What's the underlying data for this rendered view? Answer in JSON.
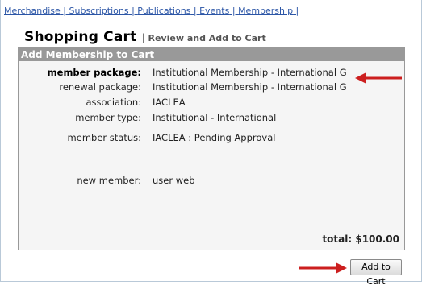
{
  "nav": {
    "links": [
      "Merchandise",
      "Subscriptions",
      "Publications",
      "Events",
      "Membership"
    ]
  },
  "header": {
    "title": "Shopping Cart",
    "subtitle": "Review and Add to Cart"
  },
  "panel": {
    "title": "Add Membership to Cart",
    "rows": [
      {
        "label": "member package:",
        "value": "Institutional Membership - International G"
      },
      {
        "label": "renewal package:",
        "value": "Institutional Membership - International G"
      },
      {
        "label": "association:",
        "value": "IACLEA"
      },
      {
        "label": "member type:",
        "value": "Institutional - International"
      },
      {
        "label": "member status:",
        "value": "IACLEA : Pending Approval"
      },
      {
        "label": "new member:",
        "value": "user web"
      }
    ],
    "total": "total: $100.00"
  },
  "actions": {
    "add_to_cart": "Add to Cart"
  },
  "colors": {
    "link": "#2b55a6",
    "panel_header": "#999999",
    "annotation_arrow": "#cc1f1f"
  }
}
